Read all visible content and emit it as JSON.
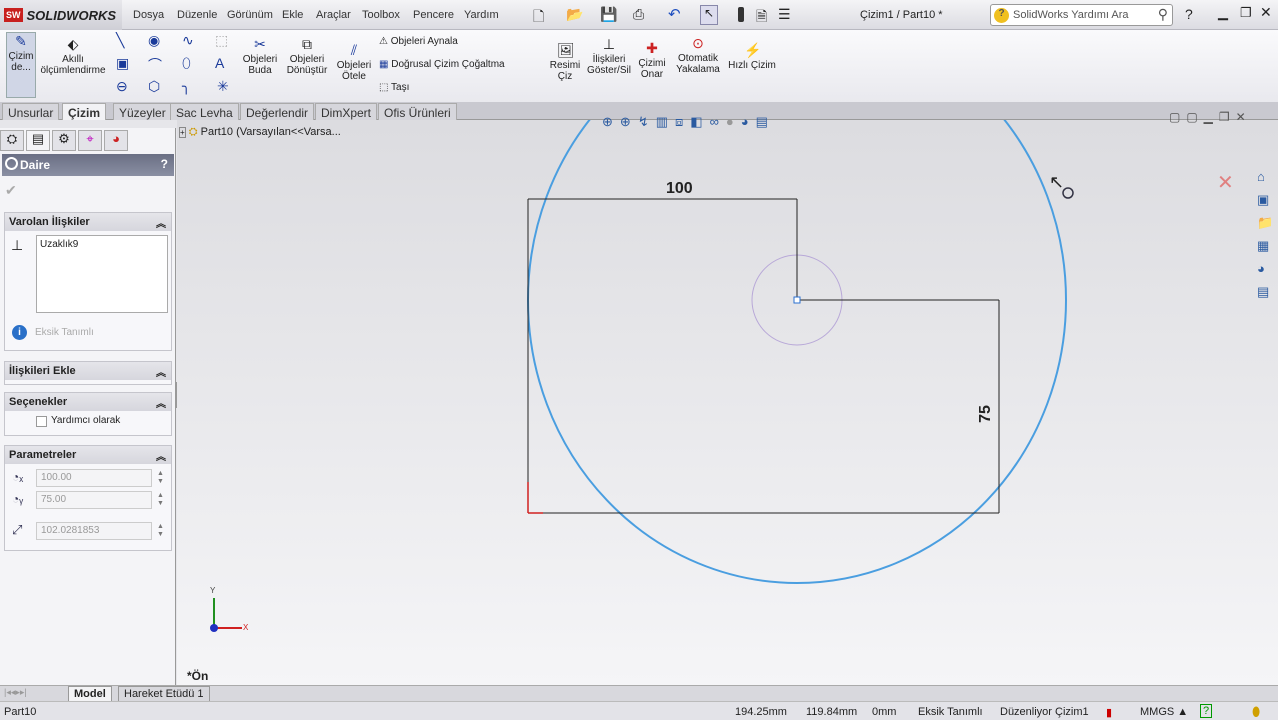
{
  "app": {
    "brand": "SOLIDWORKS",
    "doc_title": "Çizim1 / Part10 *",
    "help_search_placeholder": "SolidWorks Yardımı Ara"
  },
  "menu": [
    "Dosya",
    "Düzenle",
    "Görünüm",
    "Ekle",
    "Araçlar",
    "Toolbox",
    "Pencere",
    "Yardım"
  ],
  "ribbon": {
    "sketch": [
      "Çizim",
      "de..."
    ],
    "smart_dim": [
      "Akıllı",
      "ölçümlendirme"
    ],
    "trim": [
      "Objeleri",
      "Buda"
    ],
    "convert": [
      "Objeleri",
      "Dönüştür"
    ],
    "offset": [
      "Objeleri",
      "Ötele"
    ],
    "mirror": "Objeleri Aynala",
    "linear_pattern": "Doğrusal Çizim Çoğaltma",
    "move": "Taşı",
    "sketch_picture": [
      "Resimi",
      "Çiz"
    ],
    "relations": [
      "İlişkileri",
      "Göster/Sil"
    ],
    "repair": [
      "Çizimi",
      "Onar"
    ],
    "snap": [
      "Otomatik",
      "Yakalama"
    ],
    "rapid": "Hızlı Çizim"
  },
  "tabs": [
    "Unsurlar",
    "Çizim",
    "Yüzeyler",
    "Sac Levha",
    "Değerlendir",
    "DimXpert",
    "Ofis Ürünleri"
  ],
  "property_manager": {
    "title": "Daire",
    "help": "?",
    "existing_relations": {
      "title": "Varolan İlişkiler",
      "items": [
        "Uzaklık9"
      ],
      "status": "Eksik Tanımlı"
    },
    "add_relations": {
      "title": "İlişkileri Ekle"
    },
    "options": {
      "title": "Seçenekler",
      "construction_label": "Yardımcı olarak",
      "construction_checked": false
    },
    "parameters": {
      "title": "Parametreler",
      "cx": "100.00",
      "cy": "75.00",
      "radius": "102.0281853"
    }
  },
  "tree": {
    "root": "Part10  (Varsayılan<<Varsa..."
  },
  "canvas": {
    "dim_horizontal": "100",
    "dim_vertical": "75",
    "view_label": "*Ön",
    "axis_x": "X",
    "axis_y": "Y"
  },
  "bottom_tabs": [
    "Model",
    "Hareket Etüdü 1"
  ],
  "status": {
    "part": "Part10",
    "x": "194.25mm",
    "y": "119.84mm",
    "z": "0mm",
    "definition": "Eksik Tanımlı",
    "editing": "Düzenliyor Çizim1",
    "units": "MMGS ▲"
  }
}
